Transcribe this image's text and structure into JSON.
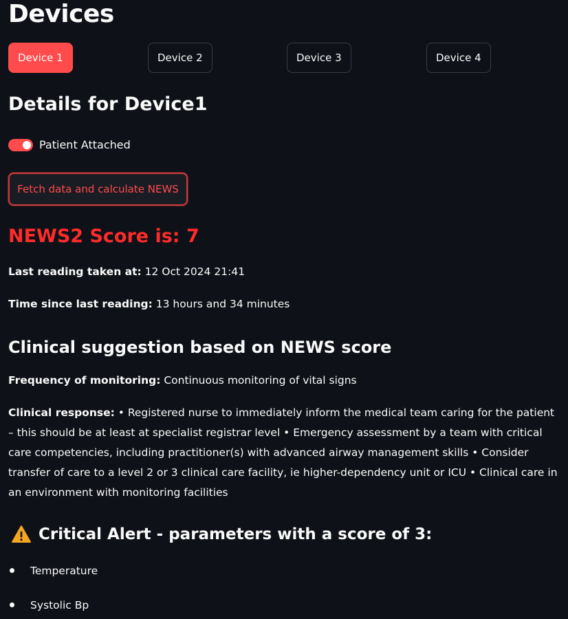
{
  "page": {
    "title": "Devices"
  },
  "devices": [
    {
      "label": "Device 1",
      "active": true
    },
    {
      "label": "Device 2",
      "active": false
    },
    {
      "label": "Device 3",
      "active": false
    },
    {
      "label": "Device 4",
      "active": false
    }
  ],
  "details": {
    "heading": "Details for Device1",
    "toggle_label": "Patient Attached",
    "toggle_on": true,
    "fetch_button": "Fetch data and calculate NEWS",
    "score_text": "NEWS2 Score is: 7",
    "last_reading_label": "Last reading taken at:",
    "last_reading_value": "12 Oct 2024 21:41",
    "time_since_label": "Time since last reading:",
    "time_since_value": "13 hours and 34 minutes"
  },
  "suggestion": {
    "heading": "Clinical suggestion based on NEWS score",
    "frequency_label": "Frequency of monitoring:",
    "frequency_value": "Continuous monitoring of vital signs",
    "response_label": "Clinical response:",
    "response_value": "• Registered nurse to immediately inform the medical team caring for the patient – this should be at least at specialist registrar level • Emergency assessment by a team with critical care competencies, including practitioner(s) with advanced airway management skills • Consider transfer of care to a level 2 or 3 clinical care facility, ie higher-dependency unit or ICU • Clinical care in an environment with monitoring facilities"
  },
  "alert": {
    "icon": "warning-icon",
    "heading": "Critical Alert - parameters with a score of 3:",
    "parameters": [
      "Temperature",
      "Systolic Bp"
    ]
  },
  "colors": {
    "accent": "#ff4b4b",
    "score": "#ff2b2b",
    "background": "#0e1117",
    "warning": "#f5a623"
  }
}
